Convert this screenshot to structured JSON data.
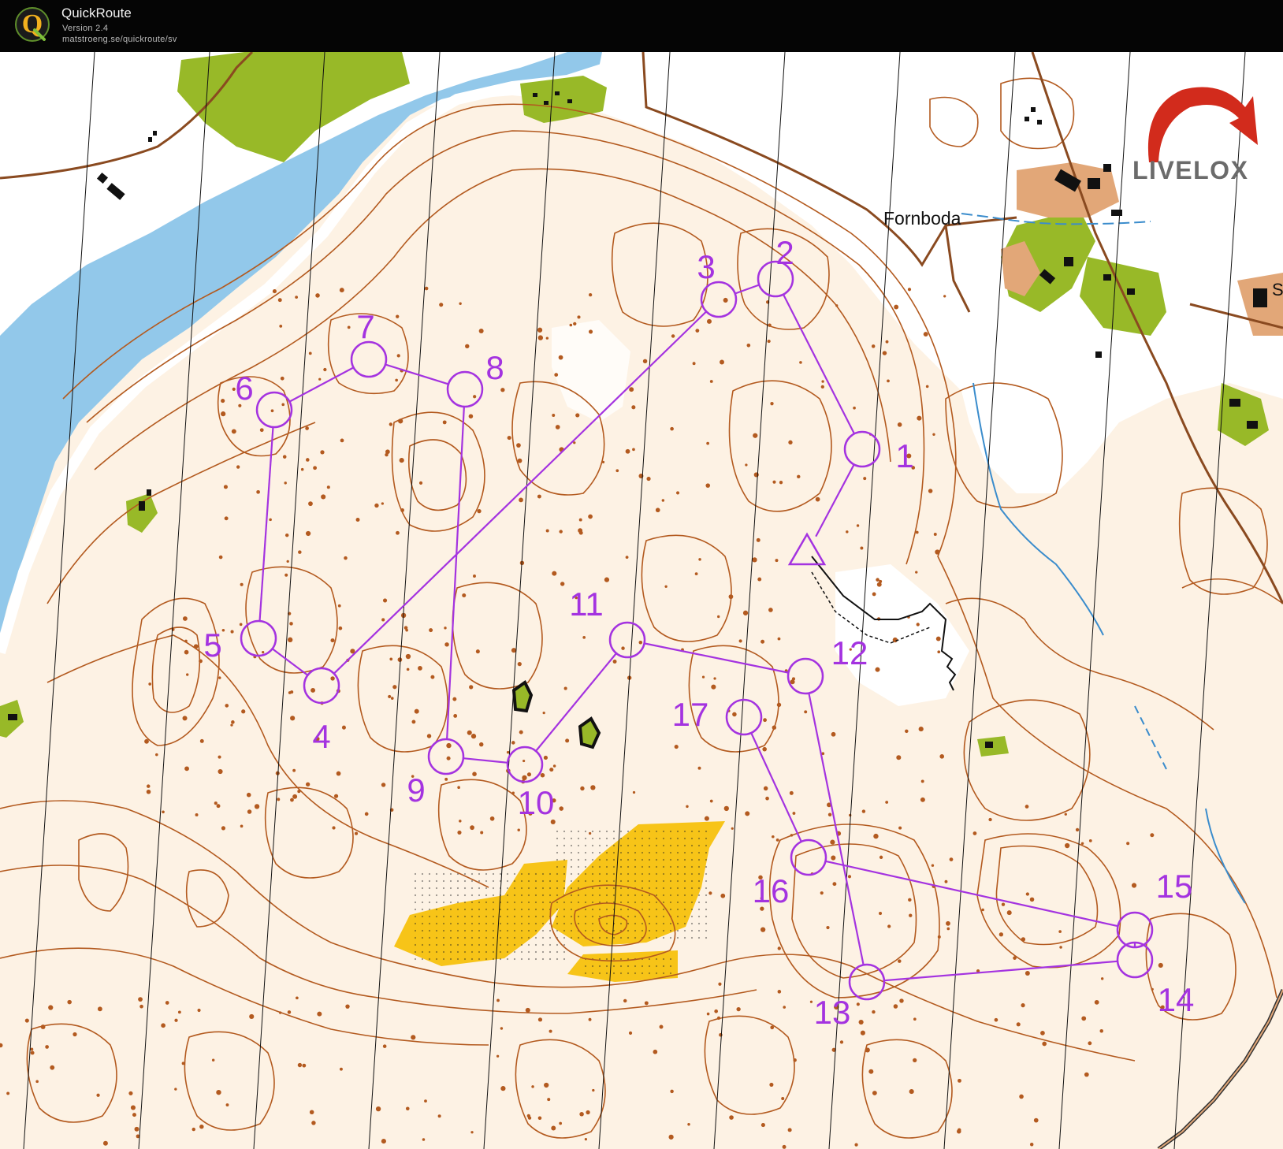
{
  "app": {
    "title": "QuickRoute",
    "version": "Version 2.4",
    "url": "matstroeng.se/quickroute/sv",
    "logo_letter": "Q"
  },
  "map": {
    "watermark": "LIVELOX",
    "place_label": "Fornboda",
    "place_label_partial": "S",
    "colors": {
      "terrain": "#fdf2e4",
      "open_land": "#ffffff",
      "water": "#92c8ea",
      "green": "#98b928",
      "yellow": "#f7c418",
      "contour": "#b35a1f",
      "road": "#8a4a20",
      "course": "#a433e0",
      "building": "#111111",
      "settlement": "#e2a778"
    },
    "controls": [
      {
        "label": "1"
      },
      {
        "label": "2"
      },
      {
        "label": "3"
      },
      {
        "label": "4"
      },
      {
        "label": "5"
      },
      {
        "label": "6"
      },
      {
        "label": "7"
      },
      {
        "label": "8"
      },
      {
        "label": "9"
      },
      {
        "label": "10"
      },
      {
        "label": "11"
      },
      {
        "label": "12"
      },
      {
        "label": "13"
      },
      {
        "label": "14"
      },
      {
        "label": "15"
      },
      {
        "label": "16"
      },
      {
        "label": "17"
      }
    ]
  }
}
